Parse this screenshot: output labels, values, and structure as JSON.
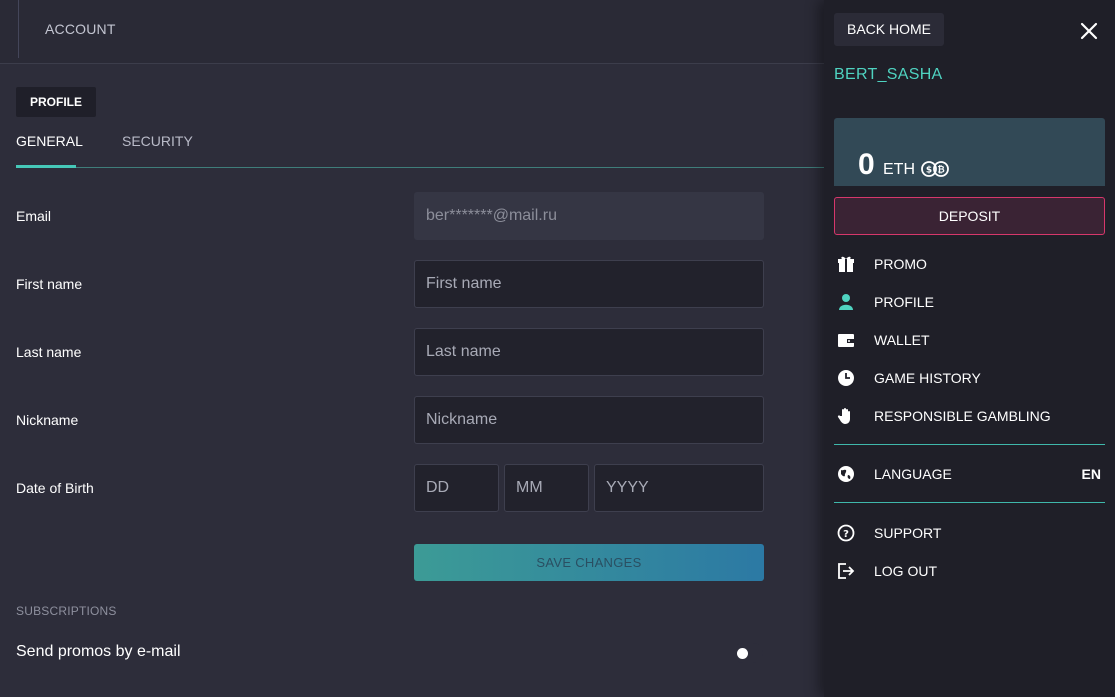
{
  "header": {
    "title": "ACCOUNT"
  },
  "profile": {
    "badge": "PROFILE",
    "tabs": [
      {
        "label": "GENERAL",
        "active": true
      },
      {
        "label": "SECURITY",
        "active": false
      }
    ]
  },
  "form": {
    "email": {
      "label": "Email",
      "value": "ber*******@mail.ru"
    },
    "first_name": {
      "label": "First name",
      "placeholder": "First name"
    },
    "last_name": {
      "label": "Last name",
      "placeholder": "Last name"
    },
    "nickname": {
      "label": "Nickname",
      "placeholder": "Nickname"
    },
    "dob": {
      "label": "Date of Birth",
      "day_placeholder": "DD",
      "month_placeholder": "MM",
      "year_placeholder": "YYYY"
    },
    "save_label": "SAVE CHANGES"
  },
  "subscriptions": {
    "heading": "SUBSCRIPTIONS",
    "promos_label": "Send promos by e-mail",
    "promos_enabled": false
  },
  "drawer": {
    "back_home": "BACK HOME",
    "username": "BERT_SASHA",
    "balance": {
      "amount": "0",
      "currency": "ETH"
    },
    "deposit_label": "DEPOSIT",
    "menu": [
      {
        "label": "PROMO",
        "icon": "gift-icon"
      },
      {
        "label": "PROFILE",
        "icon": "user-icon"
      },
      {
        "label": "WALLET",
        "icon": "wallet-icon"
      },
      {
        "label": "GAME HISTORY",
        "icon": "clock-icon"
      },
      {
        "label": "RESPONSIBLE GAMBLING",
        "icon": "hand-icon"
      }
    ],
    "language": {
      "label": "LANGUAGE",
      "value": "EN",
      "icon": "globe-icon"
    },
    "support_label": "SUPPORT",
    "logout_label": "LOG OUT"
  },
  "colors": {
    "accent": "#4fd3c1",
    "deposit_border": "#d6376b",
    "background": "#2d2d3a",
    "drawer_background": "#1f1f28"
  }
}
